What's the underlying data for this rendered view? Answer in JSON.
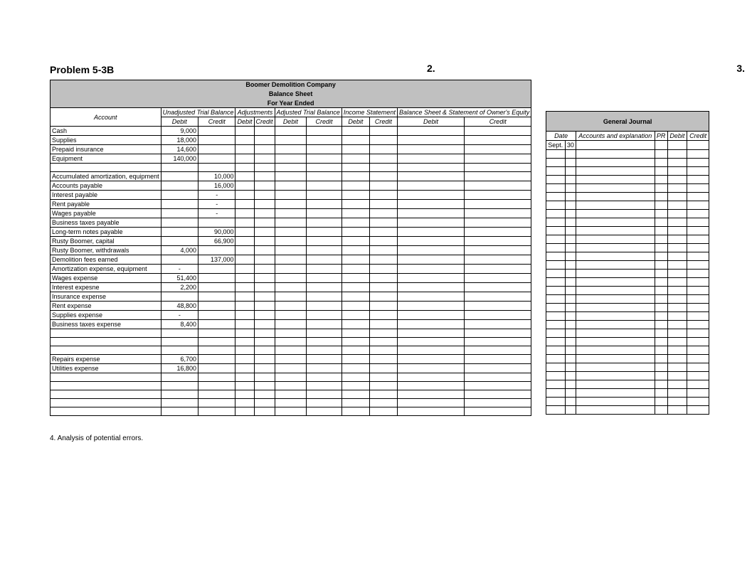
{
  "title": "Problem 5-3B",
  "marker2": "2.",
  "marker3": "3.",
  "note4": "4. Analysis of potential errors.",
  "company_header": [
    "Boomer Demolition Company",
    "Balance Sheet",
    "For Year Ended"
  ],
  "sections": {
    "account": "Account",
    "utb": "Unadjusted Trial Balance",
    "adj": "Adjustments",
    "atb": "Adjusted Trial Balance",
    "is": "Income Statement",
    "bs": "Balance Sheet & Statement of Owner's Equity",
    "debit": "Debit",
    "credit": "Credit"
  },
  "rows": [
    {
      "acct": "Cash",
      "utb_d": "9,000",
      "utb_c": ""
    },
    {
      "acct": "Supplies",
      "utb_d": "18,000",
      "utb_c": ""
    },
    {
      "acct": "Prepaid insurance",
      "utb_d": "14,600",
      "utb_c": ""
    },
    {
      "acct": "Equipment",
      "utb_d": "140,000",
      "utb_c": ""
    },
    {
      "acct": "",
      "utb_d": "",
      "utb_c": ""
    },
    {
      "acct": "Accumulated amortization, equipment",
      "utb_d": "",
      "utb_c": "10,000"
    },
    {
      "acct": "Accounts payable",
      "utb_d": "",
      "utb_c": "16,000"
    },
    {
      "acct": "Interest payable",
      "utb_d": "",
      "utb_c": "-"
    },
    {
      "acct": "Rent payable",
      "utb_d": "",
      "utb_c": "-"
    },
    {
      "acct": "Wages payable",
      "utb_d": "",
      "utb_c": "-"
    },
    {
      "acct": "Business taxes payable",
      "utb_d": "",
      "utb_c": ""
    },
    {
      "acct": "Long-term notes payable",
      "utb_d": "",
      "utb_c": "90,000"
    },
    {
      "acct": "Rusty Boomer, capital",
      "utb_d": "",
      "utb_c": "66,900"
    },
    {
      "acct": "Rusty Boomer, withdrawals",
      "utb_d": "4,000",
      "utb_c": ""
    },
    {
      "acct": "Demolition fees earned",
      "utb_d": "",
      "utb_c": "137,000"
    },
    {
      "acct": "Amortization expense, equipment",
      "utb_d": "-",
      "utb_c": ""
    },
    {
      "acct": "Wages expense",
      "utb_d": "51,400",
      "utb_c": ""
    },
    {
      "acct": "Interest expesne",
      "utb_d": "2,200",
      "utb_c": ""
    },
    {
      "acct": "Insurance expense",
      "utb_d": "",
      "utb_c": ""
    },
    {
      "acct": "Rent expense",
      "utb_d": "48,800",
      "utb_c": ""
    },
    {
      "acct": "Supplies expense",
      "utb_d": "-",
      "utb_c": ""
    },
    {
      "acct": "Business taxes expense",
      "utb_d": "8,400",
      "utb_c": ""
    },
    {
      "acct": "",
      "utb_d": "",
      "utb_c": ""
    },
    {
      "acct": "",
      "utb_d": "",
      "utb_c": ""
    },
    {
      "acct": "",
      "utb_d": "",
      "utb_c": ""
    },
    {
      "acct": "Repairs expense",
      "utb_d": "6,700",
      "utb_c": ""
    },
    {
      "acct": "Utilities expense",
      "utb_d": "16,800",
      "utb_c": ""
    },
    {
      "acct": "",
      "utb_d": "",
      "utb_c": ""
    },
    {
      "acct": "",
      "utb_d": "",
      "utb_c": ""
    },
    {
      "acct": "",
      "utb_d": "",
      "utb_c": ""
    },
    {
      "acct": "",
      "utb_d": "",
      "utb_c": ""
    },
    {
      "acct": "",
      "utb_d": "",
      "utb_c": ""
    }
  ],
  "journal": {
    "title": "General Journal",
    "cols": {
      "date": "Date",
      "expl": "Accounts and explanation",
      "pr": "PR",
      "debit": "Debit",
      "credit": "Credit"
    },
    "first_date_month": "Sept.",
    "first_date_day": "30",
    "blank_rows": 31
  }
}
